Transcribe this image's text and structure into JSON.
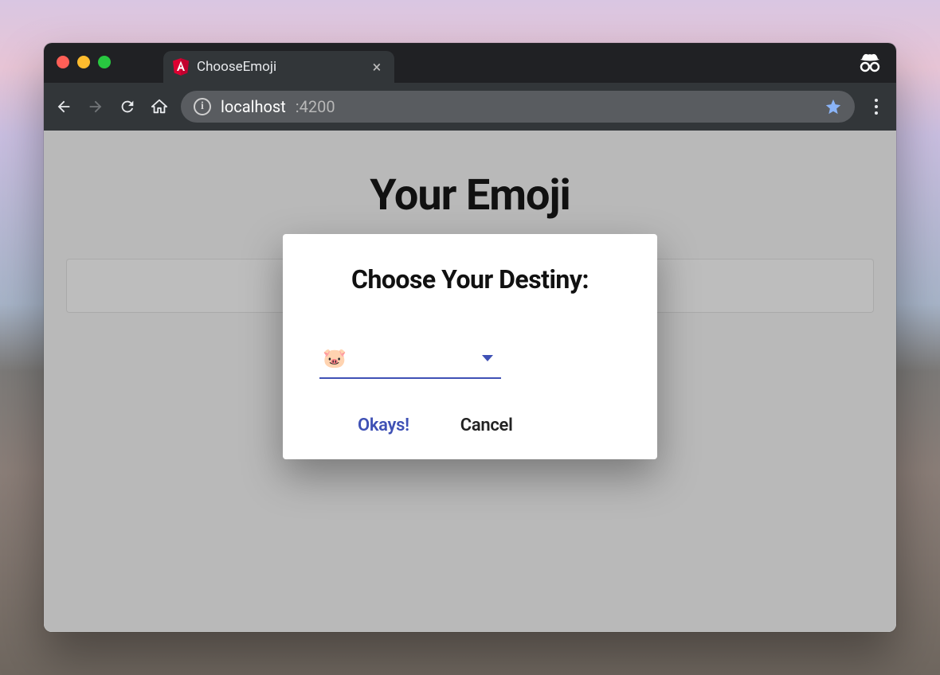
{
  "browser": {
    "tab_title": "ChooseEmoji",
    "url_host": "localhost",
    "url_port": ":4200"
  },
  "page": {
    "heading": "Your Emoji"
  },
  "dialog": {
    "title": "Choose Your Destiny:",
    "select_value": "🐷",
    "ok_label": "Okays!",
    "cancel_label": "Cancel"
  }
}
